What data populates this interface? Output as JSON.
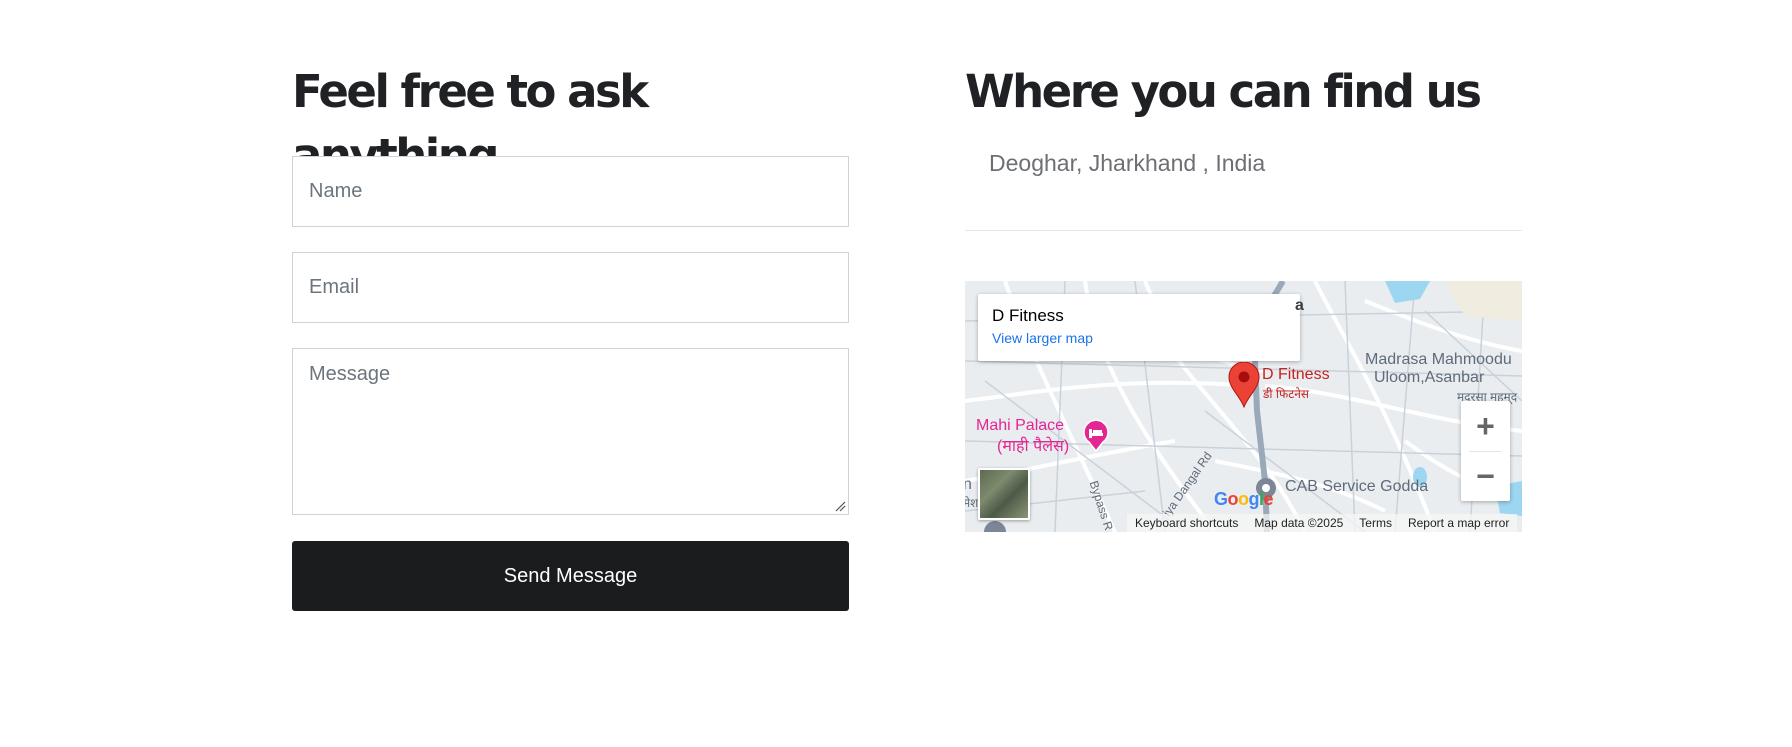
{
  "contact": {
    "heading": "Feel free to ask anything",
    "name_placeholder": "Name",
    "email_placeholder": "Email",
    "message_placeholder": "Message",
    "send_label": "Send Message"
  },
  "location": {
    "heading": "Where you can find us",
    "address": "Deoghar, Jharkhand , India"
  },
  "map": {
    "place_title": "D Fitness",
    "view_larger_label": "View larger map",
    "labels": {
      "d_fitness": "D Fitness",
      "d_fitness_hi": "डी फिटनेस",
      "madrasa_line1": "Madrasa Mahmoodu",
      "madrasa_line2": "Uloom,Asanbar",
      "madrasa_hi": "मदरसा महमूद",
      "mahi_palace": "Mahi Palace",
      "mahi_palace_hi": "(माही पैलेस)",
      "bypass_rd": "Bypass R",
      "dangal_rd": "iya Dangal Rd",
      "cab_service": "CAB Service Godda",
      "edge_n": "n",
      "edge_hi": "मेश",
      "edge_a": "a"
    },
    "zoom_in": "+",
    "zoom_out": "−",
    "google": [
      "G",
      "o",
      "o",
      "g",
      "l",
      "e"
    ],
    "attribution": {
      "keyboard": "Keyboard shortcuts",
      "map_data": "Map data ©2025",
      "terms": "Terms",
      "report": "Report a map error"
    },
    "colors": {
      "marker": "#ea4335",
      "poi_text": "#c5221f",
      "hotel": "#e52592",
      "road_major": "#9aa9ba",
      "water": "#9cd6f0",
      "label_gray": "#5f6b7a",
      "link": "#1a73e8"
    }
  }
}
